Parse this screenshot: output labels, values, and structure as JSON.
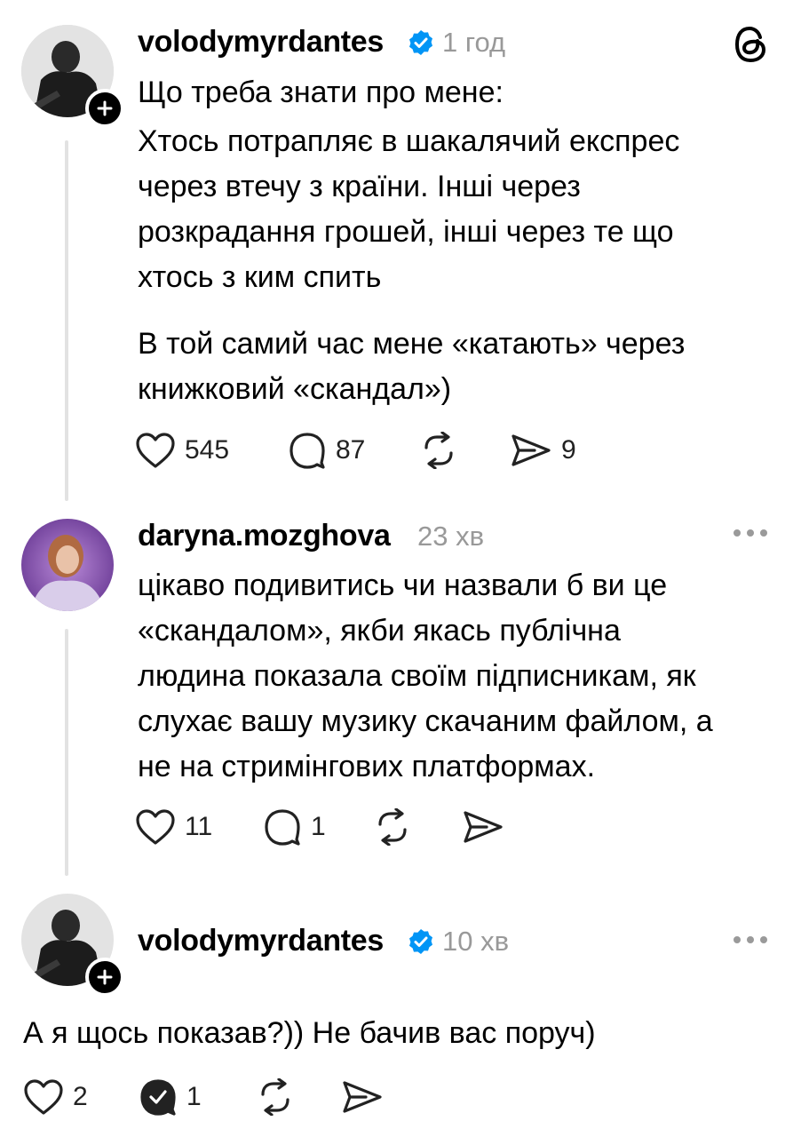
{
  "post1": {
    "username": "volodymyrdantes",
    "time": "1 год",
    "lines": [
      "Що треба знати про мене:",
      "Хтось потрапляє в шакалячий експрес",
      "через втечу з країни. Інші через",
      "розкрадання грошей, інші через те що",
      "хтось з ким спить",
      "В той самий час мене «катають» через",
      "книжковий «скандал»)"
    ],
    "likes": "545",
    "comments": "87",
    "shares": "9"
  },
  "post2": {
    "username": "daryna.mozghova",
    "time": "23 хв",
    "lines": [
      "цікаво подивитись чи назвали б ви це",
      "«скандалом», якби якась публічна",
      "людина показала своїм підписникам, як",
      "слухає вашу музику скачаним файлом, а",
      "не на стримінгових платформах."
    ],
    "likes": "11",
    "comments": "1"
  },
  "post3": {
    "username": "volodymyrdantes",
    "time": "10 хв",
    "text": "А я щось показав?)) Не бачив вас поруч)",
    "likes": "2",
    "comments": "1"
  },
  "colors": {
    "verified": "#0095f6",
    "muted": "#999999",
    "thread_line": "#e2e2e2"
  },
  "icons": [
    "threads-logo-icon",
    "verified-badge-icon",
    "plus-icon",
    "heart-icon",
    "comment-icon",
    "repost-icon",
    "share-icon",
    "more-icon"
  ]
}
